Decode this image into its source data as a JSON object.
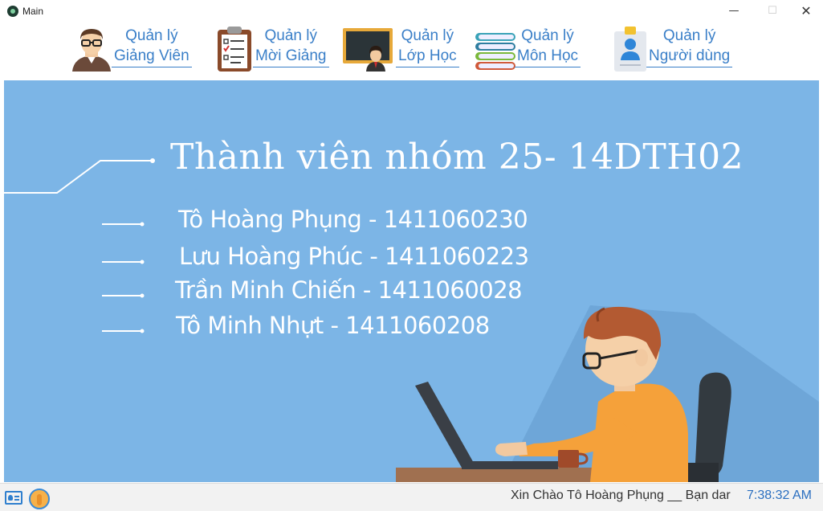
{
  "window": {
    "title": "Main",
    "minimize": "—",
    "maximize": "☐",
    "close": "✕"
  },
  "nav": [
    {
      "line1": "Quản lý",
      "line2": "Giảng Viên",
      "icon": "teacher-icon"
    },
    {
      "line1": "Quản lý",
      "line2": "Mời Giảng",
      "icon": "clipboard-icon"
    },
    {
      "line1": "Quản lý",
      "line2": "Lớp Học",
      "icon": "classroom-icon"
    },
    {
      "line1": "Quản lý",
      "line2": "Môn Học",
      "icon": "books-icon"
    },
    {
      "line1": "Quản lý",
      "line2": "Người dùng",
      "icon": "user-icon"
    }
  ],
  "banner": {
    "title": "Thành viên nhóm 25- 14DTH02",
    "members": [
      "Tô Hoàng Phụng - 1411060230",
      "Lưu Hoàng Phúc - 1411060223",
      "Trần Minh Chiến - 1411060028",
      "Tô Minh Nhựt - 1411060208"
    ],
    "background_color": "#7cb5e6"
  },
  "status": {
    "greeting": "Xin Chào Tô Hoàng Phụng __ Bạn dar",
    "time": "7:38:32 AM"
  }
}
